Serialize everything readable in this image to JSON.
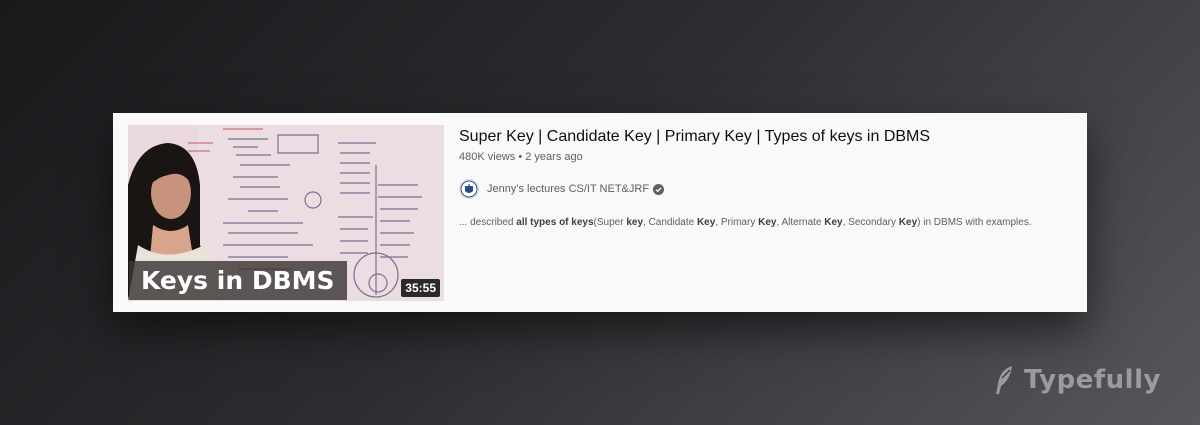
{
  "video": {
    "thumbnail_caption": "Keys in DBMS",
    "duration": "35:55",
    "title": "Super Key | Candidate Key | Primary Key | Types of keys in DBMS",
    "views": "480K views",
    "separator": "•",
    "age": "2 years ago",
    "channel": {
      "name": "Jenny's lectures CS/IT NET&JRF",
      "verified_icon": "check-circle-icon",
      "avatar_icon": "channel-logo-icon"
    },
    "snippet": [
      {
        "text": "... described ",
        "bold": false
      },
      {
        "text": "all types of keys",
        "bold": true
      },
      {
        "text": "(Super ",
        "bold": false
      },
      {
        "text": "key",
        "bold": true
      },
      {
        "text": ", Candidate ",
        "bold": false
      },
      {
        "text": "Key",
        "bold": true
      },
      {
        "text": ", Primary ",
        "bold": false
      },
      {
        "text": "Key",
        "bold": true
      },
      {
        "text": ", Alternate ",
        "bold": false
      },
      {
        "text": "Key",
        "bold": true
      },
      {
        "text": ", Secondary ",
        "bold": false
      },
      {
        "text": "Key",
        "bold": true
      },
      {
        "text": ") in DBMS with examples.",
        "bold": false
      }
    ]
  },
  "brand": {
    "name": "Typefully",
    "icon": "quill-icon"
  },
  "colors": {
    "background": "#2b2c2f",
    "card": "#f9f9f9",
    "text_primary": "#0f0f0f",
    "text_secondary": "#606060"
  }
}
